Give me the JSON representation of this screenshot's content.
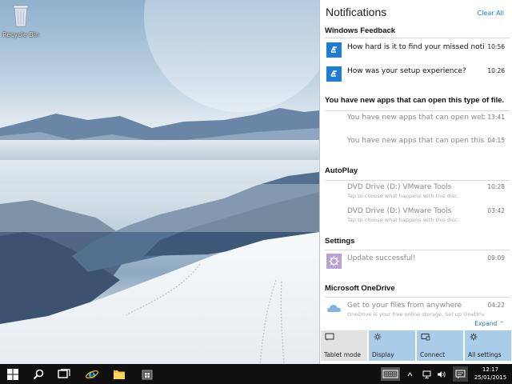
{
  "desktop": {
    "recycle_bin_label": "Recycle Bin"
  },
  "action_center": {
    "title": "Notifications",
    "clear_all": "Clear All",
    "groups": [
      {
        "title": "Windows Feedback",
        "items": [
          {
            "text": "How hard is it to find your missed notifica",
            "time": "10:56",
            "icon": "windows-feedback-icon"
          },
          {
            "text": "How was your setup experience?",
            "time": "10:26",
            "icon": "windows-feedback-icon"
          }
        ]
      },
      {
        "title": "You have new apps that can open this type of file.",
        "items": [
          {
            "text": "You have new apps that can open webpag",
            "time": "13:41"
          },
          {
            "text": "You have new apps that can open this typ",
            "time": "04:15"
          }
        ]
      },
      {
        "title": "AutoPlay",
        "items": [
          {
            "text": "DVD Drive (D:) VMware Tools",
            "sub": "Tap to choose what happens with this disc.",
            "time": "10:28"
          },
          {
            "text": "DVD Drive (D:) VMware Tools",
            "sub": "Tap to choose what happens with this disc.",
            "time": "03:42"
          }
        ]
      },
      {
        "title": "Settings",
        "items": [
          {
            "text": "Update successful!",
            "time": "09:09",
            "icon": "settings-gear-icon"
          }
        ]
      },
      {
        "title": "Microsoft OneDrive",
        "items": [
          {
            "text": "Get to your files from anywhere",
            "sub": "OneDrive is your free online storage. Set up OneDrive",
            "time": "04:22",
            "icon": "onedrive-cloud-icon"
          }
        ]
      }
    ],
    "expand_label": "Expand",
    "quick_actions": [
      {
        "label": "Tablet mode",
        "icon": "tablet-mode-icon",
        "active": false
      },
      {
        "label": "Display",
        "icon": "display-brightness-icon",
        "active": true
      },
      {
        "label": "Connect",
        "icon": "connect-icon",
        "active": true
      },
      {
        "label": "All settings",
        "icon": "all-settings-gear-icon",
        "active": true
      }
    ]
  },
  "taskbar": {
    "clock_time": "12:17",
    "clock_date": "25/01/2015"
  },
  "colors": {
    "accent": "#1979ca",
    "tile_blue": "#1e7bd6",
    "quick_active": "#a9cde9",
    "quick_inactive": "#e2e2e2",
    "taskbar": "#101010"
  }
}
